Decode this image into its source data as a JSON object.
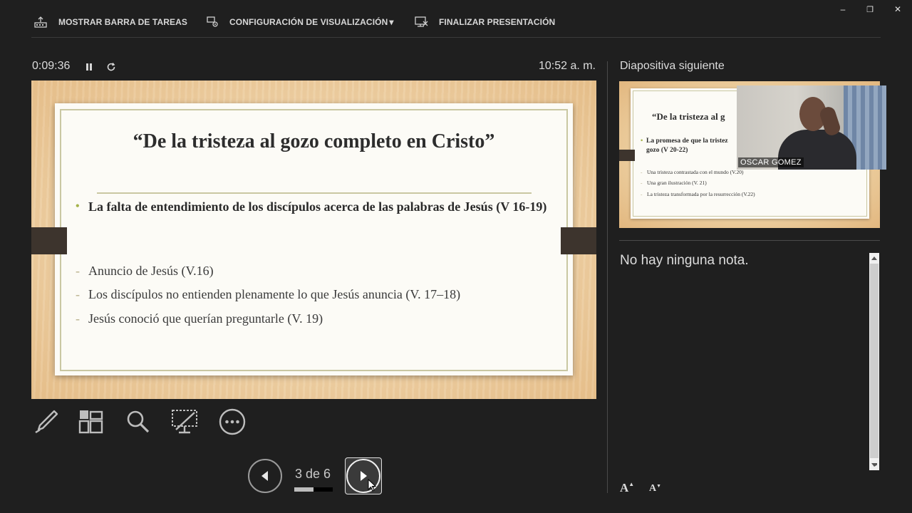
{
  "toolbar": {
    "show_taskbar": "MOSTRAR BARRA DE TAREAS",
    "display_settings": "CONFIGURACIÓN DE VISUALIZACIÓN",
    "display_settings_arrow": "▾",
    "end_show": "FINALIZAR PRESENTACIÓN"
  },
  "window_controls": {
    "minimize": "–",
    "restore": "❐",
    "close": "✕"
  },
  "presenter": {
    "timer": "0:09:36",
    "clock": "10:52 a. m."
  },
  "current_slide": {
    "title": "“De la tristeza al gozo completo en Cristo”",
    "bullet": "La falta de entendimiento de los discípulos acerca de las palabras de Jesús (V 16-19)",
    "subpoints": [
      "Anuncio de Jesús (V.16)",
      "Los discípulos no entienden plenamente lo que Jesús anuncia (V. 17–18)",
      "Jesús conoció que querían preguntarle (V. 19)"
    ]
  },
  "tools": [
    "pen-tool",
    "see-all-slides",
    "zoom",
    "black-screen",
    "more-options"
  ],
  "navigation": {
    "counter": "3 de 6",
    "progress": 0.5
  },
  "next_panel": {
    "label": "Diapositiva siguiente",
    "title": "“De la tristeza al g",
    "bullet_line1": "La promesa de que la tristez",
    "bullet_line2": "gozo (V 20-22)",
    "subpoints": [
      "Una tristeza contrastada con el mundo (V.20)",
      "Una gran ilustración (V. 21)",
      "La tristeza transformada por la resurrección (V.22)"
    ]
  },
  "webcam": {
    "name": "OSCAR GOMEZ"
  },
  "notes": {
    "text": "No hay ninguna nota."
  },
  "font_controls": {
    "increase": "A",
    "decrease": "A"
  },
  "colors": {
    "background": "#1f1f1f",
    "slide_accent": "#a5b34a",
    "frame": "#c9c7a2"
  }
}
